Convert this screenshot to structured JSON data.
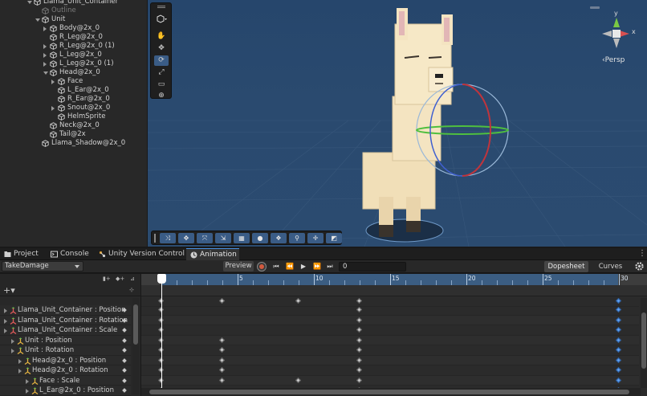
{
  "hierarchy": {
    "items": [
      {
        "label": "Llama_Unit_Container",
        "depth": 0,
        "expand": "down",
        "dim": false
      },
      {
        "label": "Outline",
        "depth": 1,
        "expand": "none",
        "dim": true
      },
      {
        "label": "Unit",
        "depth": 1,
        "expand": "down",
        "dim": false
      },
      {
        "label": "Body@2x_0",
        "depth": 2,
        "expand": "right",
        "dim": false
      },
      {
        "label": "R_Leg@2x_0",
        "depth": 2,
        "expand": "none",
        "dim": false
      },
      {
        "label": "R_Leg@2x_0 (1)",
        "depth": 2,
        "expand": "right",
        "dim": false
      },
      {
        "label": "L_Leg@2x_0",
        "depth": 2,
        "expand": "right",
        "dim": false
      },
      {
        "label": "L_Leg@2x_0 (1)",
        "depth": 2,
        "expand": "right",
        "dim": false
      },
      {
        "label": "Head@2x_0",
        "depth": 2,
        "expand": "down",
        "dim": false
      },
      {
        "label": "Face",
        "depth": 3,
        "expand": "right",
        "dim": false
      },
      {
        "label": "L_Ear@2x_0",
        "depth": 3,
        "expand": "none",
        "dim": false
      },
      {
        "label": "R_Ear@2x_0",
        "depth": 3,
        "expand": "none",
        "dim": false
      },
      {
        "label": "Snout@2x_0",
        "depth": 3,
        "expand": "right",
        "dim": false
      },
      {
        "label": "HelmSprite",
        "depth": 3,
        "expand": "none",
        "dim": false
      },
      {
        "label": "Neck@2x_0",
        "depth": 2,
        "expand": "none",
        "dim": false
      },
      {
        "label": "Tail@2x",
        "depth": 2,
        "expand": "none",
        "dim": false
      },
      {
        "label": "Llama_Shadow@2x_0",
        "depth": 1,
        "expand": "none",
        "dim": false
      }
    ]
  },
  "scene": {
    "persp_label": "‹Persp",
    "gizmo_axes": {
      "y": "y",
      "x": "x"
    },
    "tools": [
      "hand-tool",
      "move-tool",
      "rotate-tool",
      "scale-tool",
      "rect-tool",
      "transform-tool"
    ],
    "bottom_tools_count": 10
  },
  "tabs": [
    {
      "label": "Project",
      "icon": "folder-icon",
      "active": false
    },
    {
      "label": "Console",
      "icon": "console-icon",
      "active": false
    },
    {
      "label": "Unity Version Control",
      "icon": "version-control-icon",
      "active": false
    },
    {
      "label": "Animation",
      "icon": "animation-icon",
      "active": true
    }
  ],
  "animation": {
    "clip": "TakeDamage",
    "preview_label": "Preview",
    "frame": "0",
    "dopesheet_label": "Dopesheet",
    "curves_label": "Curves",
    "add_property": "+▾",
    "properties": [
      {
        "label": "Llama_Unit_Container : Position",
        "indent": 0
      },
      {
        "label": "Llama_Unit_Container : Rotation",
        "indent": 0
      },
      {
        "label": "Llama_Unit_Container : Scale",
        "indent": 0
      },
      {
        "label": "Unit : Position",
        "indent": 1
      },
      {
        "label": "Unit : Rotation",
        "indent": 1
      },
      {
        "label": "Head@2x_0 : Position",
        "indent": 2
      },
      {
        "label": "Head@2x_0 : Rotation",
        "indent": 2
      },
      {
        "label": "Face : Scale",
        "indent": 3
      },
      {
        "label": "L_Ear@2x_0 : Position",
        "indent": 3
      }
    ],
    "ruler_labels": [
      "5",
      "10",
      "15",
      "20",
      "25",
      "30"
    ],
    "summary_keys": [
      0,
      4,
      9,
      13,
      30
    ],
    "row_keys": [
      [
        0,
        13,
        30
      ],
      [
        0,
        13,
        30
      ],
      [
        0,
        13,
        30
      ],
      [
        0,
        4,
        13,
        30
      ],
      [
        0,
        4,
        13,
        30
      ],
      [
        0,
        4,
        13,
        30
      ],
      [
        0,
        4,
        13,
        30
      ],
      [
        0,
        4,
        9,
        13,
        30
      ],
      [
        0,
        13,
        30
      ]
    ]
  }
}
